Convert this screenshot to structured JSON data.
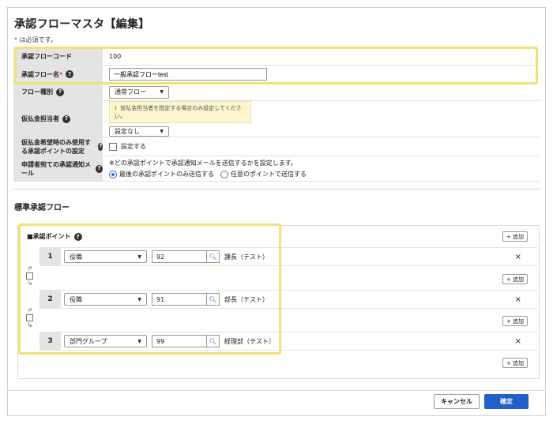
{
  "page": {
    "title": "承認フローマスタ【編集】",
    "required_note_star": "*",
    "required_note": " は必須です。"
  },
  "form": {
    "code_label": "承認フローコード",
    "code_value": "100",
    "name_label": "承認フロー名",
    "name_star": "*",
    "name_value": "一般承認フローtest",
    "type_label": "フロー種別",
    "type_value": "通常フロー",
    "advance_label": "仮払金担当者",
    "advance_warning": "仮払金担当者を指定する場合のみ設定してください。",
    "advance_value": "設定なし",
    "approval_point_label": "仮払金希望時のみ使用する承認ポイントの設定",
    "approval_point_checkbox": "設定する",
    "notify_label": "申請者宛ての承認通知メール",
    "notify_note": "※どの承認ポイントで承認通知メールを送信するかを設定します。",
    "notify_option_last": "最後の承認ポイントのみ送信する",
    "notify_option_any": "任意のポイントで送信する"
  },
  "flow": {
    "section_title": "標準承認フロー",
    "point_heading": "■承認ポイント",
    "add_label": "+ 追加",
    "remove_label": "×",
    "steps": [
      {
        "num": "1",
        "type": "役職",
        "code": "92",
        "name": "課長（テスト）"
      },
      {
        "num": "2",
        "type": "役職",
        "code": "91",
        "name": "部長（テスト）"
      },
      {
        "num": "3",
        "type": "部門グループ",
        "code": "99",
        "name": "経理部（テスト）"
      }
    ]
  },
  "footer": {
    "cancel_label": "キャンセル",
    "confirm_label": "確定"
  },
  "colors": {
    "accent": "#2060c8",
    "highlight": "#f4df7b",
    "required": "#d33333",
    "header_bg": "#e4e4e4"
  }
}
